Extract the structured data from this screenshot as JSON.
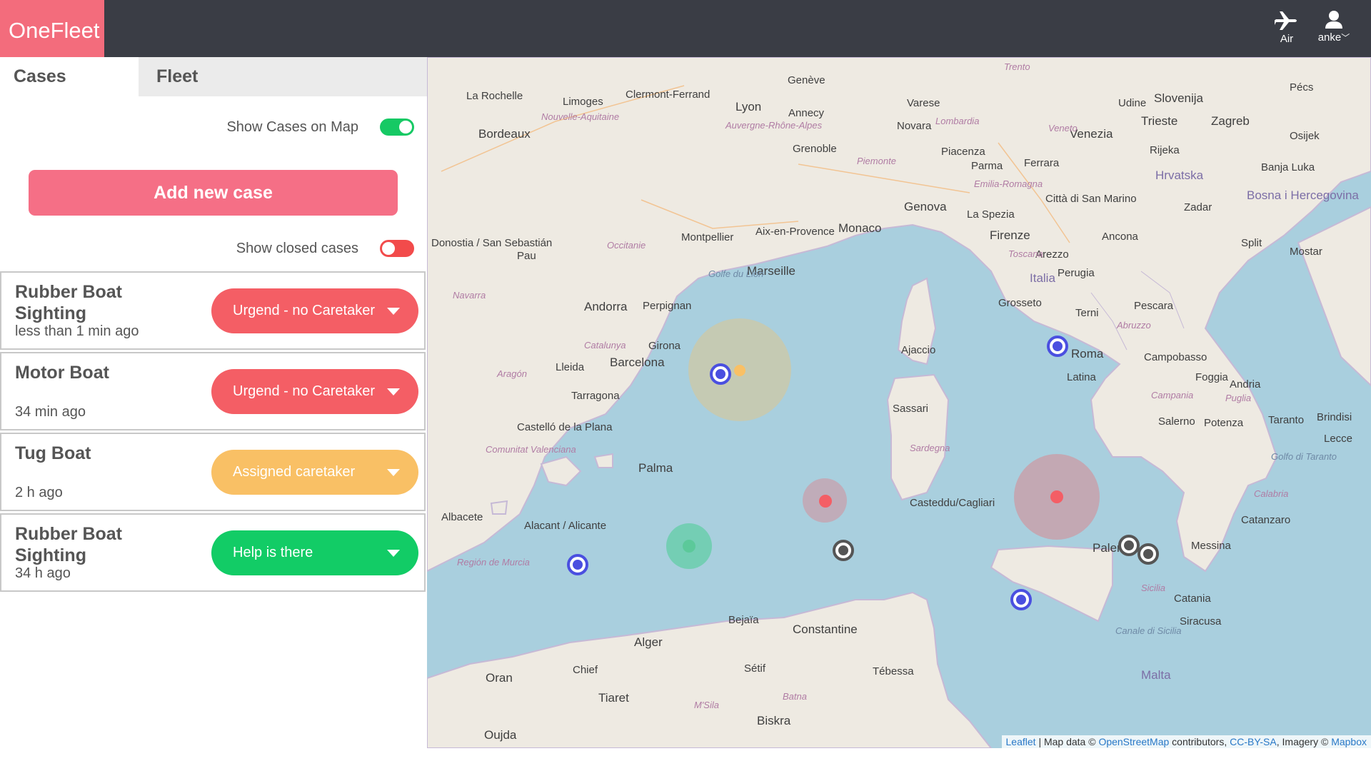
{
  "app": {
    "logo": "OneFleet"
  },
  "topbar": {
    "air_label": "Air",
    "user_label": "anke"
  },
  "tabs": [
    {
      "label": "Cases"
    },
    {
      "label": "Fleet"
    }
  ],
  "controls": {
    "show_cases_label": "Show Cases on Map",
    "show_cases_on": true,
    "add_case_label": "Add new case",
    "show_closed_label": "Show closed cases",
    "show_closed_on": false
  },
  "cases": [
    {
      "title": "Rubber Boat Sighting",
      "time": "less than 1 min ago",
      "status": "Urgend - no Caretaker",
      "status_color": "#f45e65"
    },
    {
      "title": "Motor Boat",
      "time": "34 min ago",
      "status": "Urgend - no Caretaker",
      "status_color": "#f45e65"
    },
    {
      "title": "Tug Boat",
      "time": "2 h ago",
      "status": "Assigned caretaker",
      "status_color": "#f9c065"
    },
    {
      "title": "Rubber Boat Sighting",
      "time": "34 h ago",
      "status": "Help is there",
      "status_color": "#12cc66"
    }
  ],
  "map": {
    "places": [
      "Bordeaux",
      "La Rochelle",
      "Limoges",
      "Clermont-Ferrand",
      "Lyon",
      "Genève",
      "Annecy",
      "Grenoble",
      "Varese",
      "Novara",
      "Trento",
      "Udine",
      "Trieste",
      "Venezia",
      "Slovenija",
      "Zagreb",
      "Pécs",
      "Osijek",
      "Rijeka",
      "Hrvatska",
      "Banja Luka",
      "Bosna i Hercegovina",
      "Zadar",
      "Split",
      "Mostar",
      "Piacenza",
      "Parma",
      "Ferrara",
      "Genova",
      "La Spezia",
      "Firenze",
      "Città di San Marino",
      "Ancona",
      "Arezzo",
      "Perugia",
      "Italia",
      "Grosseto",
      "Terni",
      "Pescara",
      "Roma",
      "Latina",
      "Campobasso",
      "Foggia",
      "Andria",
      "Taranto",
      "Brindisi",
      "Lecce",
      "Salerno",
      "Potenza",
      "Catanzaro",
      "Messina",
      "Palermo",
      "Catania",
      "Siracusa",
      "Malta",
      "Monaco",
      "Montpellier",
      "Marseille",
      "Aix-en-Provence",
      "Donostia / San Sebastián",
      "Pau",
      "Andorra",
      "Perpignan",
      "Girona",
      "Barcelona",
      "Lleida",
      "Tarragona",
      "Castelló de la Plana",
      "Palma",
      "Albacete",
      "Alacant / Alicante",
      "Oran",
      "Alger",
      "Chief",
      "Tiaret",
      "Bejaïa",
      "Constantine",
      "Sétif",
      "Biskra",
      "Tébessa",
      "Ajaccio",
      "Sassari",
      "Casteddu/Cagliari",
      "Oujda",
      "Sicilia",
      "Sardegna",
      "Nouvelle-Aquitaine",
      "Occitanie",
      "Auvergne-Rhône-Alpes",
      "Lombardia",
      "Veneto",
      "Piemonte",
      "Emilia-Romagna",
      "Toscana",
      "Abruzzo",
      "Campania",
      "Puglia",
      "Calabria",
      "Catalunya",
      "Aragón",
      "Comunitat Valenciana",
      "Navarra",
      "Región de Murcia",
      "Golfe du Lion",
      "Golfo di Taranto",
      "Canale di Sicilia",
      "M'Sila",
      "Batna"
    ],
    "markers": [
      {
        "kind": "boat",
        "color": "#4a4fe0"
      },
      {
        "kind": "boat",
        "color": "#4a4fe0"
      },
      {
        "kind": "boat",
        "color": "#4a4fe0"
      },
      {
        "kind": "boat",
        "color": "#4a4fe0"
      },
      {
        "kind": "case-area",
        "color": "#f9c065"
      },
      {
        "kind": "case-area",
        "color": "#f45e65"
      },
      {
        "kind": "case-area",
        "color": "#f45e65"
      },
      {
        "kind": "case-area",
        "color": "#12cc66"
      },
      {
        "kind": "vessel",
        "color": "#555555"
      },
      {
        "kind": "vessel",
        "color": "#555555"
      },
      {
        "kind": "vessel",
        "color": "#555555"
      }
    ],
    "attribution": {
      "leaflet": "Leaflet",
      "map_data": "| Map data ©",
      "osm": "OpenStreetMap",
      "contributors": "contributors,",
      "license": "CC-BY-SA",
      "imagery": ", Imagery ©",
      "mapbox": "Mapbox"
    }
  }
}
